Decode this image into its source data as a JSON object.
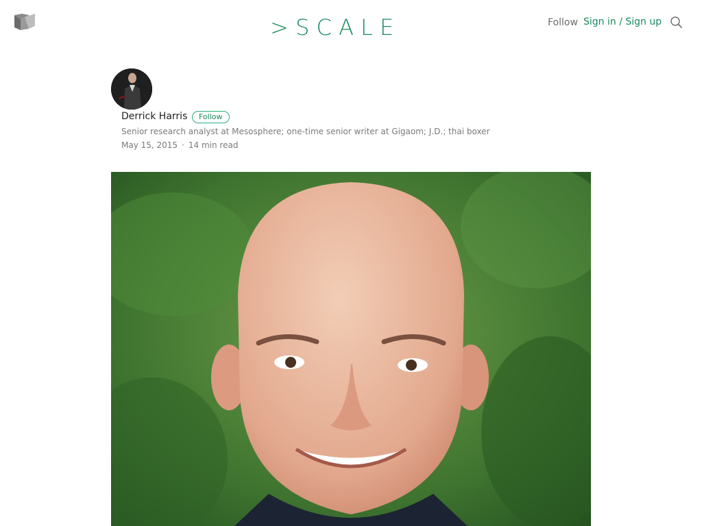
{
  "header": {
    "brand": "> S C A L E",
    "follow_label": "Follow",
    "sign_label": "Sign in / Sign up",
    "brand_color": "#1a8a5e"
  },
  "author": {
    "name": "Derrick Harris",
    "follow_label": "Follow",
    "bio": "Senior research analyst at Mesosphere; one-time senior writer at Gigaom; J.D.; thai boxer",
    "date": "May 15, 2015",
    "separator": "·",
    "read_time": "14 min read"
  },
  "icons": {
    "logo": "medium-logo-icon",
    "search": "search-icon"
  }
}
